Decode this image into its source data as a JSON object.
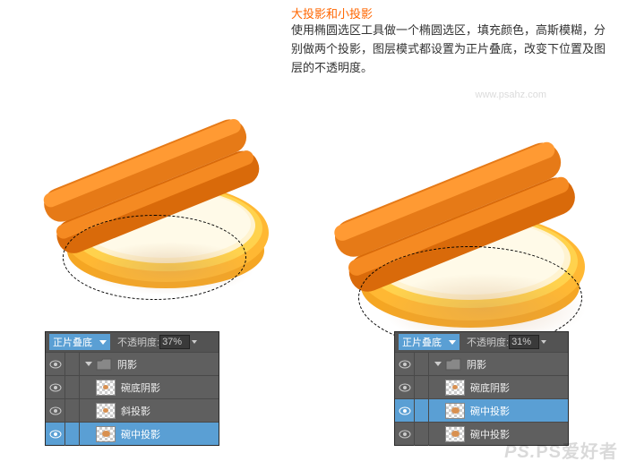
{
  "title": "大投影和小投影",
  "description": "使用椭圆选区工具做一个椭圆选区，填充颜色，高斯模糊，分别做两个投影，图层模式都设置为正片叠底，改变下位置及图层的不透明度。",
  "url_watermark": "www.psahz.com",
  "brand_watermark": "PS爱好者",
  "panels": {
    "left": {
      "blend_mode": "正片叠底",
      "opacity_label": "不透明度:",
      "opacity_value": "37%",
      "group_name": "阴影",
      "layers": [
        {
          "name": "碗底阴影",
          "selected": false
        },
        {
          "name": "斜投影",
          "selected": false
        },
        {
          "name": "碗中投影",
          "selected": true
        }
      ]
    },
    "right": {
      "blend_mode": "正片叠底",
      "opacity_label": "不透明度:",
      "opacity_value": "31%",
      "group_name": "阴影",
      "layers": [
        {
          "name": "碗底阴影",
          "selected": false
        },
        {
          "name": "碗中投影",
          "selected": true
        },
        {
          "name": "碗中投影",
          "selected": false
        }
      ]
    }
  }
}
